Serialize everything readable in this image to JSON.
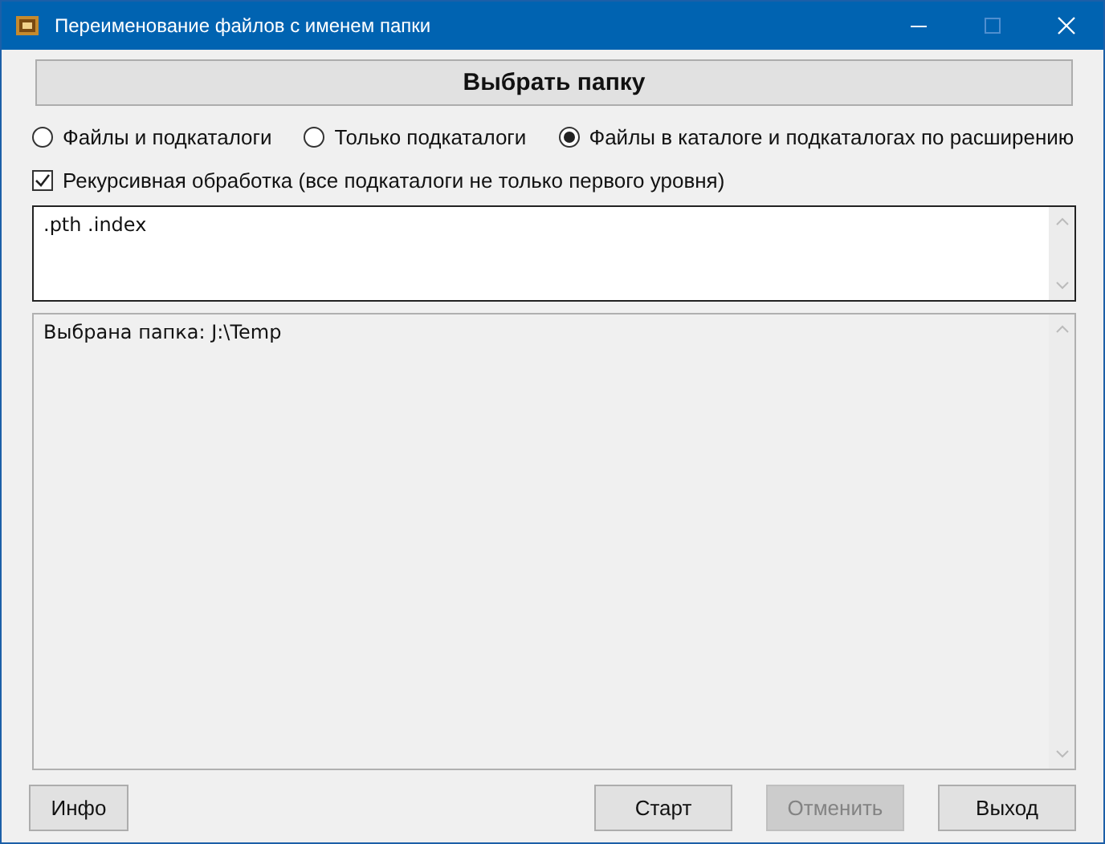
{
  "window": {
    "title": "Переименование файлов с именем папки"
  },
  "select_button": {
    "label": "Выбрать папку"
  },
  "modes": [
    {
      "label": "Файлы и подкаталоги",
      "selected": false
    },
    {
      "label": "Только подкаталоги",
      "selected": false
    },
    {
      "label": "Файлы в каталоге и подкаталогах по расширению",
      "selected": true
    }
  ],
  "recursive": {
    "label": "Рекурсивная обработка (все подкаталоги не только первого уровня)",
    "checked": true
  },
  "extensions_field": {
    "value": ".pth .index"
  },
  "log": {
    "value": "Выбрана папка: J:\\Temp"
  },
  "buttons": [
    {
      "label": "Инфо",
      "disabled": false,
      "kind": "left"
    },
    {
      "label": "Старт",
      "disabled": false,
      "kind": "right"
    },
    {
      "label": "Отменить",
      "disabled": true,
      "kind": "right"
    },
    {
      "label": "Выход",
      "disabled": false,
      "kind": "right"
    }
  ]
}
